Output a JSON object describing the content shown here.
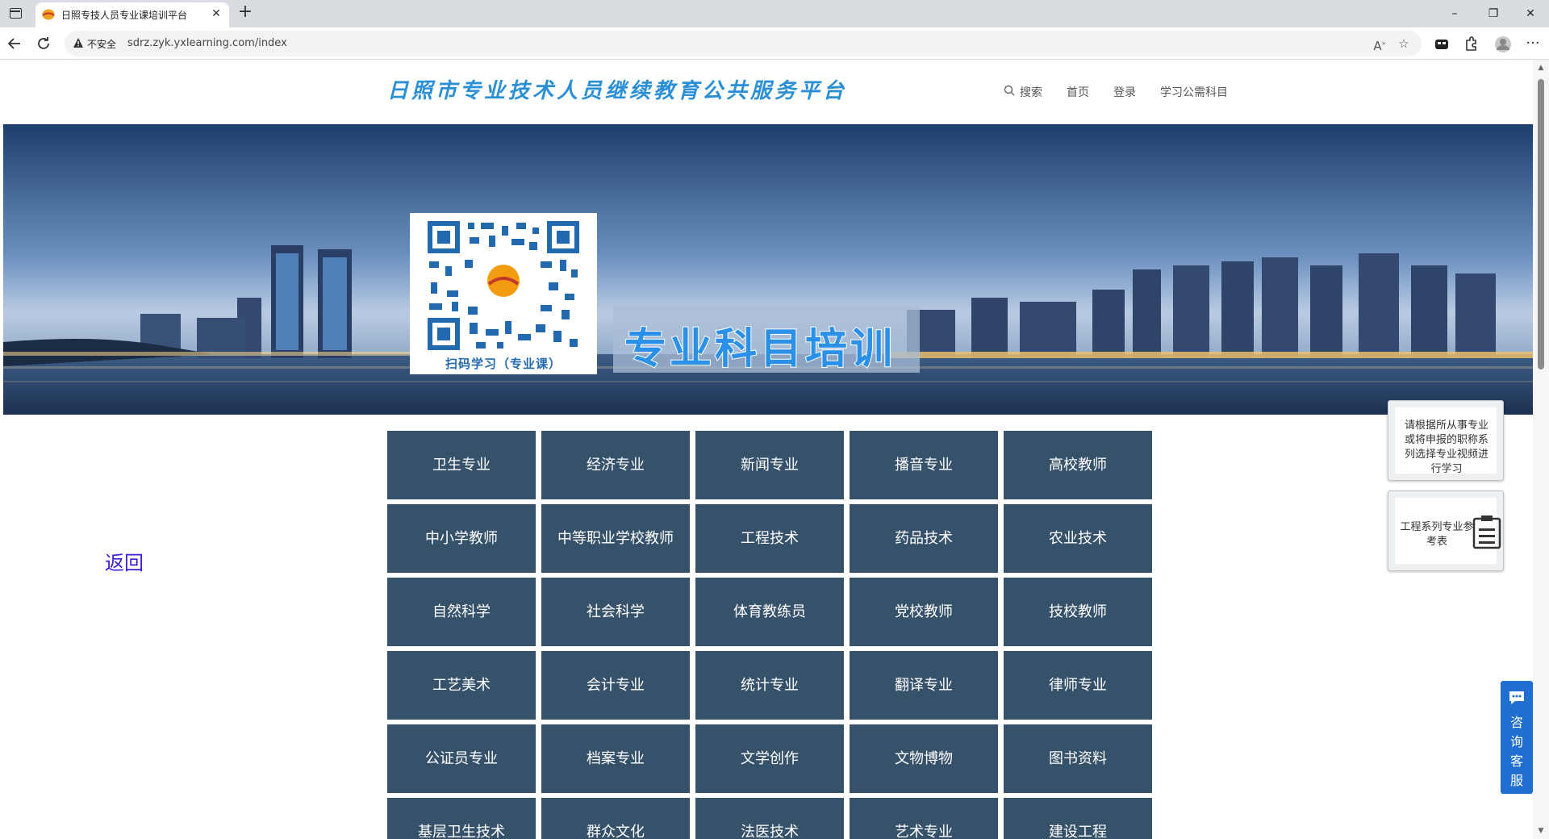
{
  "browser": {
    "tab_title": "日照专技人员专业课培训平台",
    "tab_close": "✕",
    "new_tab": "+",
    "security_label": "不安全",
    "url": "sdrz.zyk.yxlearning.com/index",
    "window_minimize": "–",
    "window_maximize": "❐",
    "window_close": "✕"
  },
  "header": {
    "site_title": "日照市专业技术人员继续教育公共服务平台",
    "nav": {
      "search": "搜索",
      "home": "首页",
      "login": "登录",
      "required_subjects": "学习公需科目"
    }
  },
  "banner": {
    "qr_caption": "扫码学习（专业课）",
    "label": "专业科目培训"
  },
  "back_link": "返回",
  "categories": [
    [
      "卫生专业",
      "经济专业",
      "新闻专业",
      "播音专业",
      "高校教师"
    ],
    [
      "中小学教师",
      "中等职业学校教师",
      "工程技术",
      "药品技术",
      "农业技术"
    ],
    [
      "自然科学",
      "社会科学",
      "体育教练员",
      "党校教师",
      "技校教师"
    ],
    [
      "工艺美术",
      "会计专业",
      "统计专业",
      "翻译专业",
      "律师专业"
    ],
    [
      "公证员专业",
      "档案专业",
      "文学创作",
      "文物博物",
      "图书资料"
    ],
    [
      "基层卫生技术",
      "群众文化",
      "法医技术",
      "艺术专业",
      "建设工程"
    ]
  ],
  "side_panel": {
    "hint_text": "请根据所从事专业或将申报的职称系列选择专业视频进行学习",
    "engineering_ref": "工程系列专业参考表"
  },
  "chat_widget": "咨询客服",
  "colors": {
    "title_blue": "#2b8fd6",
    "tile_bg": "#36526a",
    "back_link": "#3a1fd8",
    "chat_bg": "#1e6fd0"
  }
}
